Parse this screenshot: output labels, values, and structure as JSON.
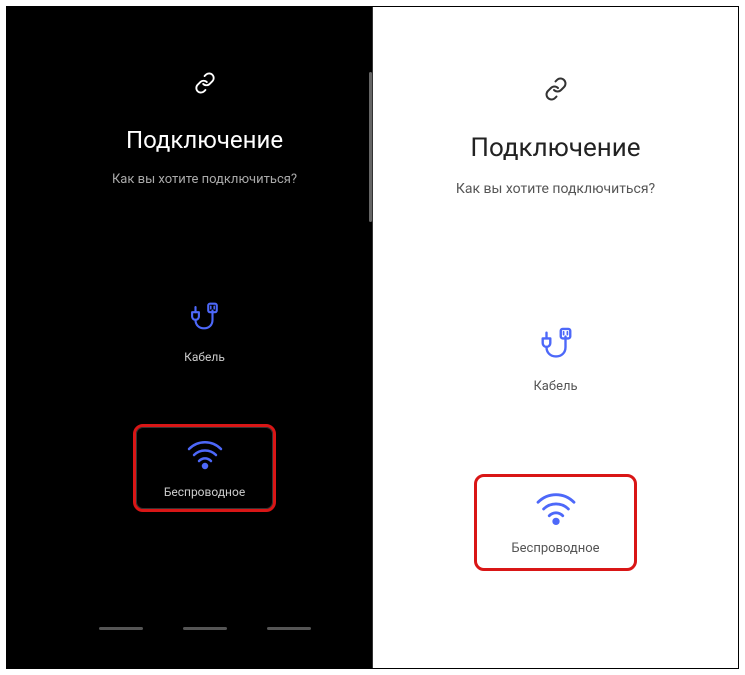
{
  "left": {
    "title": "Подключение",
    "subtitle": "Как вы хотите подключиться?",
    "cable_label": "Кабель",
    "wireless_label": "Беспроводное"
  },
  "right": {
    "title": "Подключение",
    "subtitle": "Как вы хотите подключиться?",
    "cable_label": "Кабель",
    "wireless_label": "Беспроводное"
  },
  "colors": {
    "accent": "#4d68f9",
    "highlight": "#d91616"
  }
}
